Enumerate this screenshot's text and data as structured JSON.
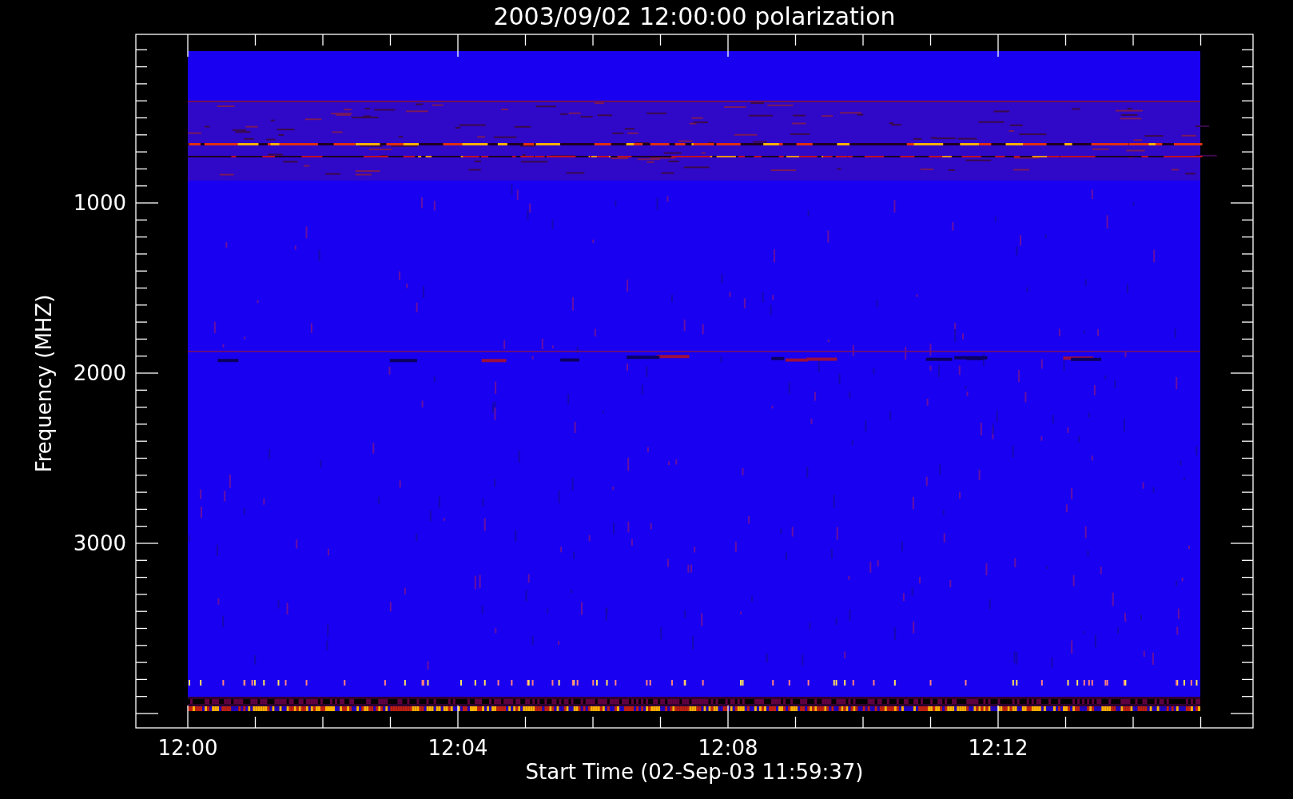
{
  "title": "2003/09/02 12:00:00 polarization",
  "y_axis": {
    "label": "Frequency (MHZ)",
    "tick_labels": [
      "1000",
      "2000",
      "3000"
    ]
  },
  "x_axis": {
    "label": "Start Time (02-Sep-03 11:59:37)",
    "tick_labels": [
      "12:00",
      "12:04",
      "12:08",
      "12:12"
    ]
  }
}
